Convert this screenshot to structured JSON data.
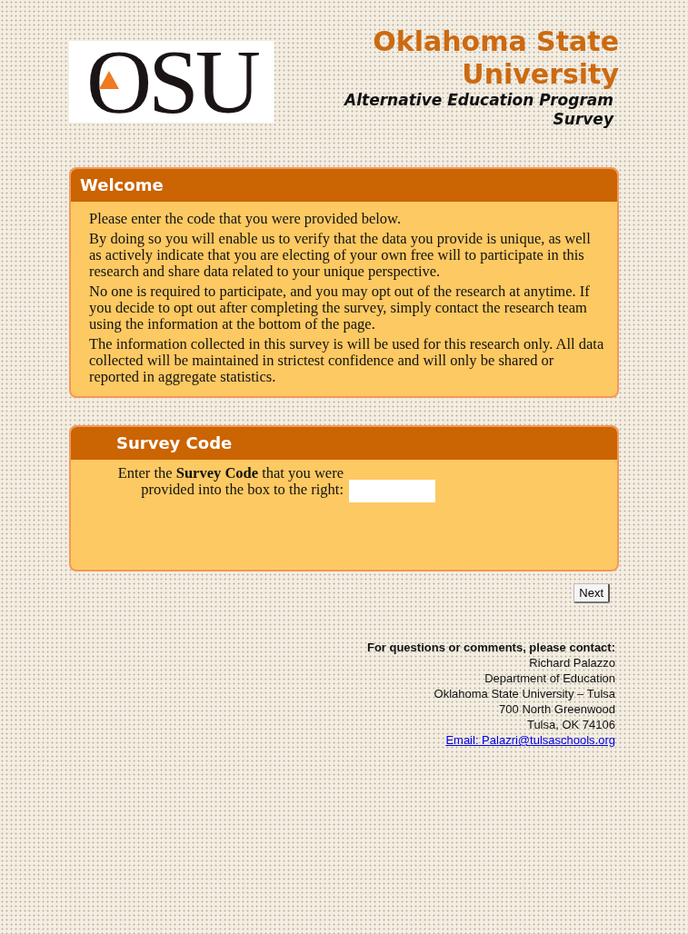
{
  "header": {
    "logo_text": "OSU",
    "title_line_1": "Oklahoma State",
    "title_line_2": "University",
    "subtitle_line_1": "Alternative Education Program",
    "subtitle_line_2": "Survey"
  },
  "welcome_panel": {
    "title": "Welcome",
    "paragraphs": [
      "Please enter the code that you were provided below.",
      "By doing so you will enable us to verify that the data you provide is unique, as well as actively indicate that you are electing of your own free will to participate in this research and share data related to your unique perspective.",
      "No one is required to participate, and you may opt out of the research at anytime. If you decide to opt out after completing the survey, simply contact the research team using the information at the bottom of the page.",
      "The information collected in this survey is will be used for this research only. All data collected will be maintained in strictest confidence and will only be shared or reported in aggregate statistics."
    ]
  },
  "survey_code_panel": {
    "title": "Survey Code",
    "label": "Enter the **Survey Code** that you were provided into the box to the right:"
  },
  "next_button": "Next",
  "contact": {
    "heading": "For questions or comments, please contact:",
    "lines": [
      "Richard Palazzo",
      "Department of Education",
      "Oklahoma State University – Tulsa",
      "700 North Greenwood",
      "Tulsa, OK 74106"
    ],
    "email_link": "Email: Palazri@tulsaschools.org"
  }
}
